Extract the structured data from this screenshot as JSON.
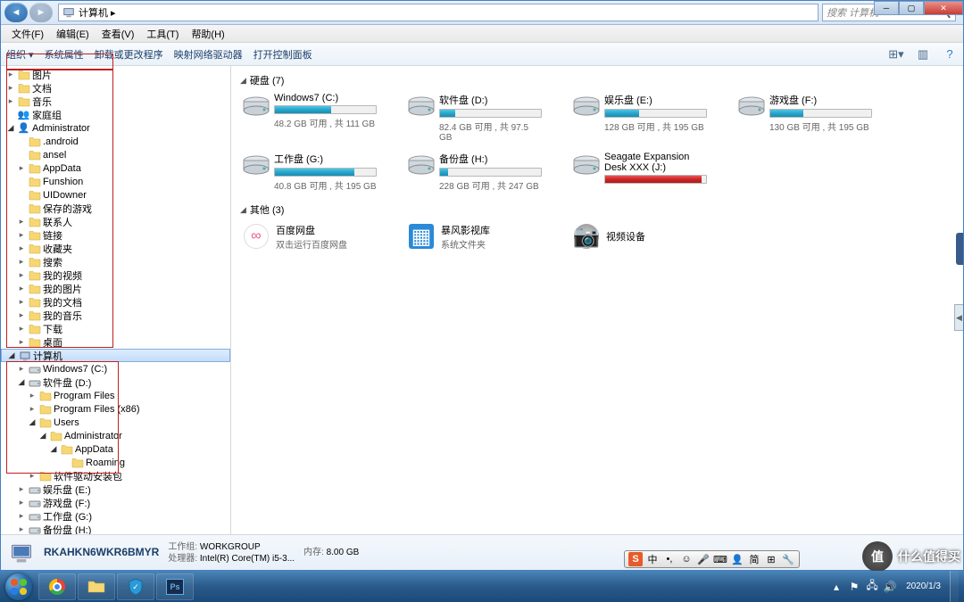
{
  "title": "计算机",
  "breadcrumb": "计算机 ▸",
  "search_placeholder": "搜索 计算机",
  "menu": {
    "file": "文件(F)",
    "edit": "编辑(E)",
    "view": "查看(V)",
    "tools": "工具(T)",
    "help": "帮助(H)"
  },
  "cmdbar": {
    "organize": "组织 ▾",
    "sysprops": "系统属性",
    "uninstall": "卸载或更改程序",
    "mapnet": "映射网络驱动器",
    "opencp": "打开控制面板"
  },
  "tree": {
    "pictures": "图片",
    "documents": "文档",
    "music": "音乐",
    "homegroup": "家庭组",
    "administrator": "Administrator",
    "android": ".android",
    "ansel": "ansel",
    "appdata": "AppData",
    "funshion": "Funshion",
    "uidowner": "UIDowner",
    "savedgames": "保存的游戏",
    "contacts": "联系人",
    "links": "链接",
    "favorites": "收藏夹",
    "search": "搜索",
    "myvideos": "我的视频",
    "mypictures": "我的图片",
    "mydocs": "我的文档",
    "mymusic": "我的音乐",
    "downloads": "下载",
    "desktop": "桌面",
    "computer": "计算机",
    "win7c": "Windows7 (C:)",
    "softd": "软件盘 (D:)",
    "progfiles": "Program Files",
    "progfiles86": "Program Files (x86)",
    "users": "Users",
    "admin2": "Administrator",
    "appdata2": "AppData",
    "roaming": "Roaming",
    "drvpack": "软件驱动安装包",
    "ente": "娱乐盘 (E:)",
    "gamef": "游戏盘 (F:)",
    "workg": "工作盘 (G:)",
    "backh": "备份盘 (H:)",
    "seagate": "Seagate Expansion Desk XXX (J:)",
    "baofeng": "暴风影视库"
  },
  "sections": {
    "drives": "硬盘 (7)",
    "other": "其他 (3)"
  },
  "drives": [
    {
      "name": "Windows7 (C:)",
      "stats": "48.2 GB 可用 , 共 111 GB",
      "pct": 56,
      "color": "blue"
    },
    {
      "name": "软件盘 (D:)",
      "stats": "82.4 GB 可用 , 共 97.5 GB",
      "pct": 15,
      "color": "blue"
    },
    {
      "name": "娱乐盘 (E:)",
      "stats": "128 GB 可用 , 共 195 GB",
      "pct": 34,
      "color": "blue"
    },
    {
      "name": "游戏盘 (F:)",
      "stats": "130 GB 可用 , 共 195 GB",
      "pct": 33,
      "color": "blue"
    },
    {
      "name": "工作盘 (G:)",
      "stats": "40.8 GB 可用 , 共 195 GB",
      "pct": 79,
      "color": "blue"
    },
    {
      "name": "备份盘 (H:)",
      "stats": "228 GB 可用 , 共 247 GB",
      "pct": 8,
      "color": "blue"
    },
    {
      "name": "Seagate Expansion Desk XXX (J:)",
      "stats": "",
      "pct": 96,
      "color": "red"
    }
  ],
  "other_items": [
    {
      "name": "百度网盘",
      "sub": "双击运行百度网盘"
    },
    {
      "name": "暴风影视库",
      "sub": "系统文件夹"
    },
    {
      "name": "视频设备",
      "sub": ""
    }
  ],
  "detail": {
    "name": "RKAHKN6WKR6BMYR",
    "workgroup_label": "工作组:",
    "workgroup": "WORKGROUP",
    "cpu_label": "处理器:",
    "cpu": "Intel(R) Core(TM) i5-3...",
    "mem_label": "内存:",
    "mem": "8.00 GB"
  },
  "ime": {
    "lang": "中",
    "punct": "•,",
    "mic": "🎤",
    "keyb": "⌨",
    "person": "👤",
    "tool": "简",
    "grid": "⊞"
  },
  "watermark": "什么值得买",
  "clock": {
    "time": "",
    "date": "2020/1/3"
  }
}
